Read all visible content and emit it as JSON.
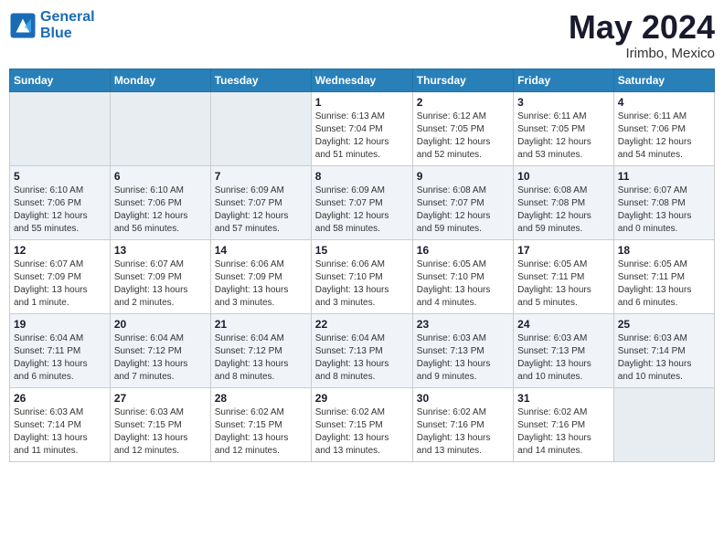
{
  "logo": {
    "line1": "General",
    "line2": "Blue"
  },
  "title": {
    "month_year": "May 2024",
    "location": "Irimbo, Mexico"
  },
  "days_header": [
    "Sunday",
    "Monday",
    "Tuesday",
    "Wednesday",
    "Thursday",
    "Friday",
    "Saturday"
  ],
  "weeks": [
    [
      {
        "day": "",
        "info": ""
      },
      {
        "day": "",
        "info": ""
      },
      {
        "day": "",
        "info": ""
      },
      {
        "day": "1",
        "info": "Sunrise: 6:13 AM\nSunset: 7:04 PM\nDaylight: 12 hours\nand 51 minutes."
      },
      {
        "day": "2",
        "info": "Sunrise: 6:12 AM\nSunset: 7:05 PM\nDaylight: 12 hours\nand 52 minutes."
      },
      {
        "day": "3",
        "info": "Sunrise: 6:11 AM\nSunset: 7:05 PM\nDaylight: 12 hours\nand 53 minutes."
      },
      {
        "day": "4",
        "info": "Sunrise: 6:11 AM\nSunset: 7:06 PM\nDaylight: 12 hours\nand 54 minutes."
      }
    ],
    [
      {
        "day": "5",
        "info": "Sunrise: 6:10 AM\nSunset: 7:06 PM\nDaylight: 12 hours\nand 55 minutes."
      },
      {
        "day": "6",
        "info": "Sunrise: 6:10 AM\nSunset: 7:06 PM\nDaylight: 12 hours\nand 56 minutes."
      },
      {
        "day": "7",
        "info": "Sunrise: 6:09 AM\nSunset: 7:07 PM\nDaylight: 12 hours\nand 57 minutes."
      },
      {
        "day": "8",
        "info": "Sunrise: 6:09 AM\nSunset: 7:07 PM\nDaylight: 12 hours\nand 58 minutes."
      },
      {
        "day": "9",
        "info": "Sunrise: 6:08 AM\nSunset: 7:07 PM\nDaylight: 12 hours\nand 59 minutes."
      },
      {
        "day": "10",
        "info": "Sunrise: 6:08 AM\nSunset: 7:08 PM\nDaylight: 12 hours\nand 59 minutes."
      },
      {
        "day": "11",
        "info": "Sunrise: 6:07 AM\nSunset: 7:08 PM\nDaylight: 13 hours\nand 0 minutes."
      }
    ],
    [
      {
        "day": "12",
        "info": "Sunrise: 6:07 AM\nSunset: 7:09 PM\nDaylight: 13 hours\nand 1 minute."
      },
      {
        "day": "13",
        "info": "Sunrise: 6:07 AM\nSunset: 7:09 PM\nDaylight: 13 hours\nand 2 minutes."
      },
      {
        "day": "14",
        "info": "Sunrise: 6:06 AM\nSunset: 7:09 PM\nDaylight: 13 hours\nand 3 minutes."
      },
      {
        "day": "15",
        "info": "Sunrise: 6:06 AM\nSunset: 7:10 PM\nDaylight: 13 hours\nand 3 minutes."
      },
      {
        "day": "16",
        "info": "Sunrise: 6:05 AM\nSunset: 7:10 PM\nDaylight: 13 hours\nand 4 minutes."
      },
      {
        "day": "17",
        "info": "Sunrise: 6:05 AM\nSunset: 7:11 PM\nDaylight: 13 hours\nand 5 minutes."
      },
      {
        "day": "18",
        "info": "Sunrise: 6:05 AM\nSunset: 7:11 PM\nDaylight: 13 hours\nand 6 minutes."
      }
    ],
    [
      {
        "day": "19",
        "info": "Sunrise: 6:04 AM\nSunset: 7:11 PM\nDaylight: 13 hours\nand 6 minutes."
      },
      {
        "day": "20",
        "info": "Sunrise: 6:04 AM\nSunset: 7:12 PM\nDaylight: 13 hours\nand 7 minutes."
      },
      {
        "day": "21",
        "info": "Sunrise: 6:04 AM\nSunset: 7:12 PM\nDaylight: 13 hours\nand 8 minutes."
      },
      {
        "day": "22",
        "info": "Sunrise: 6:04 AM\nSunset: 7:13 PM\nDaylight: 13 hours\nand 8 minutes."
      },
      {
        "day": "23",
        "info": "Sunrise: 6:03 AM\nSunset: 7:13 PM\nDaylight: 13 hours\nand 9 minutes."
      },
      {
        "day": "24",
        "info": "Sunrise: 6:03 AM\nSunset: 7:13 PM\nDaylight: 13 hours\nand 10 minutes."
      },
      {
        "day": "25",
        "info": "Sunrise: 6:03 AM\nSunset: 7:14 PM\nDaylight: 13 hours\nand 10 minutes."
      }
    ],
    [
      {
        "day": "26",
        "info": "Sunrise: 6:03 AM\nSunset: 7:14 PM\nDaylight: 13 hours\nand 11 minutes."
      },
      {
        "day": "27",
        "info": "Sunrise: 6:03 AM\nSunset: 7:15 PM\nDaylight: 13 hours\nand 12 minutes."
      },
      {
        "day": "28",
        "info": "Sunrise: 6:02 AM\nSunset: 7:15 PM\nDaylight: 13 hours\nand 12 minutes."
      },
      {
        "day": "29",
        "info": "Sunrise: 6:02 AM\nSunset: 7:15 PM\nDaylight: 13 hours\nand 13 minutes."
      },
      {
        "day": "30",
        "info": "Sunrise: 6:02 AM\nSunset: 7:16 PM\nDaylight: 13 hours\nand 13 minutes."
      },
      {
        "day": "31",
        "info": "Sunrise: 6:02 AM\nSunset: 7:16 PM\nDaylight: 13 hours\nand 14 minutes."
      },
      {
        "day": "",
        "info": ""
      }
    ]
  ]
}
